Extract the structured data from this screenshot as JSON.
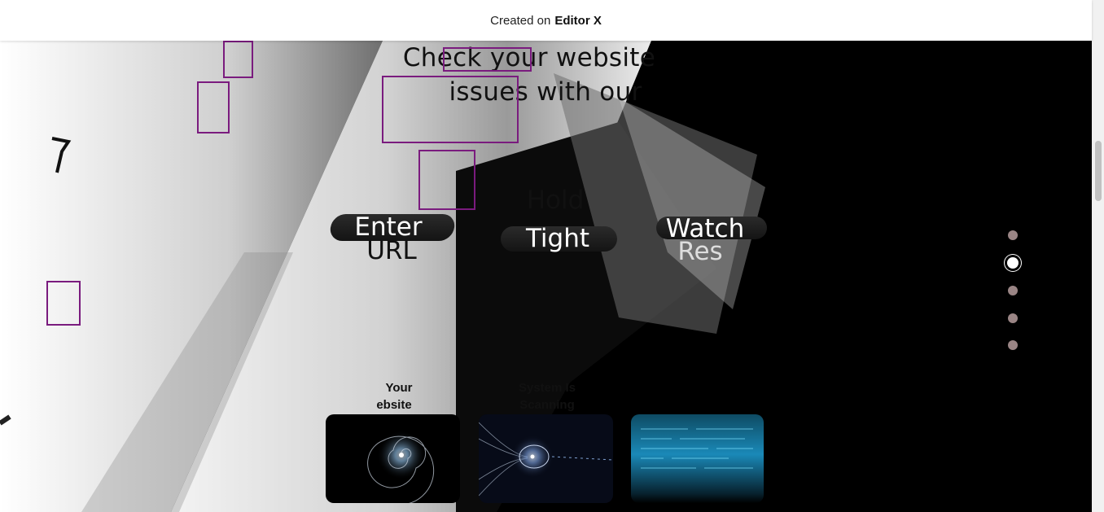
{
  "topbar": {
    "created_on": "Created on",
    "brand": "Editor X"
  },
  "hero": {
    "headline_line1": "Check your website",
    "headline_line2": "issues with our"
  },
  "steps": [
    {
      "label_line1": "Enter",
      "label_line2": "URL"
    },
    {
      "label_line1": "Hold",
      "label_line2": "Tight"
    },
    {
      "label_line1": "Watch",
      "label_line2": "Res"
    }
  ],
  "cards": [
    {
      "title_line1": "Your",
      "title_line2": "ebsite"
    },
    {
      "title_line1": "System Is",
      "title_line2": "Scanning"
    }
  ],
  "section_nav": {
    "count": 5,
    "active_index": 1
  },
  "colors": {
    "outline_accent": "#7a1b7e",
    "nav_dot": "#9a8585"
  }
}
